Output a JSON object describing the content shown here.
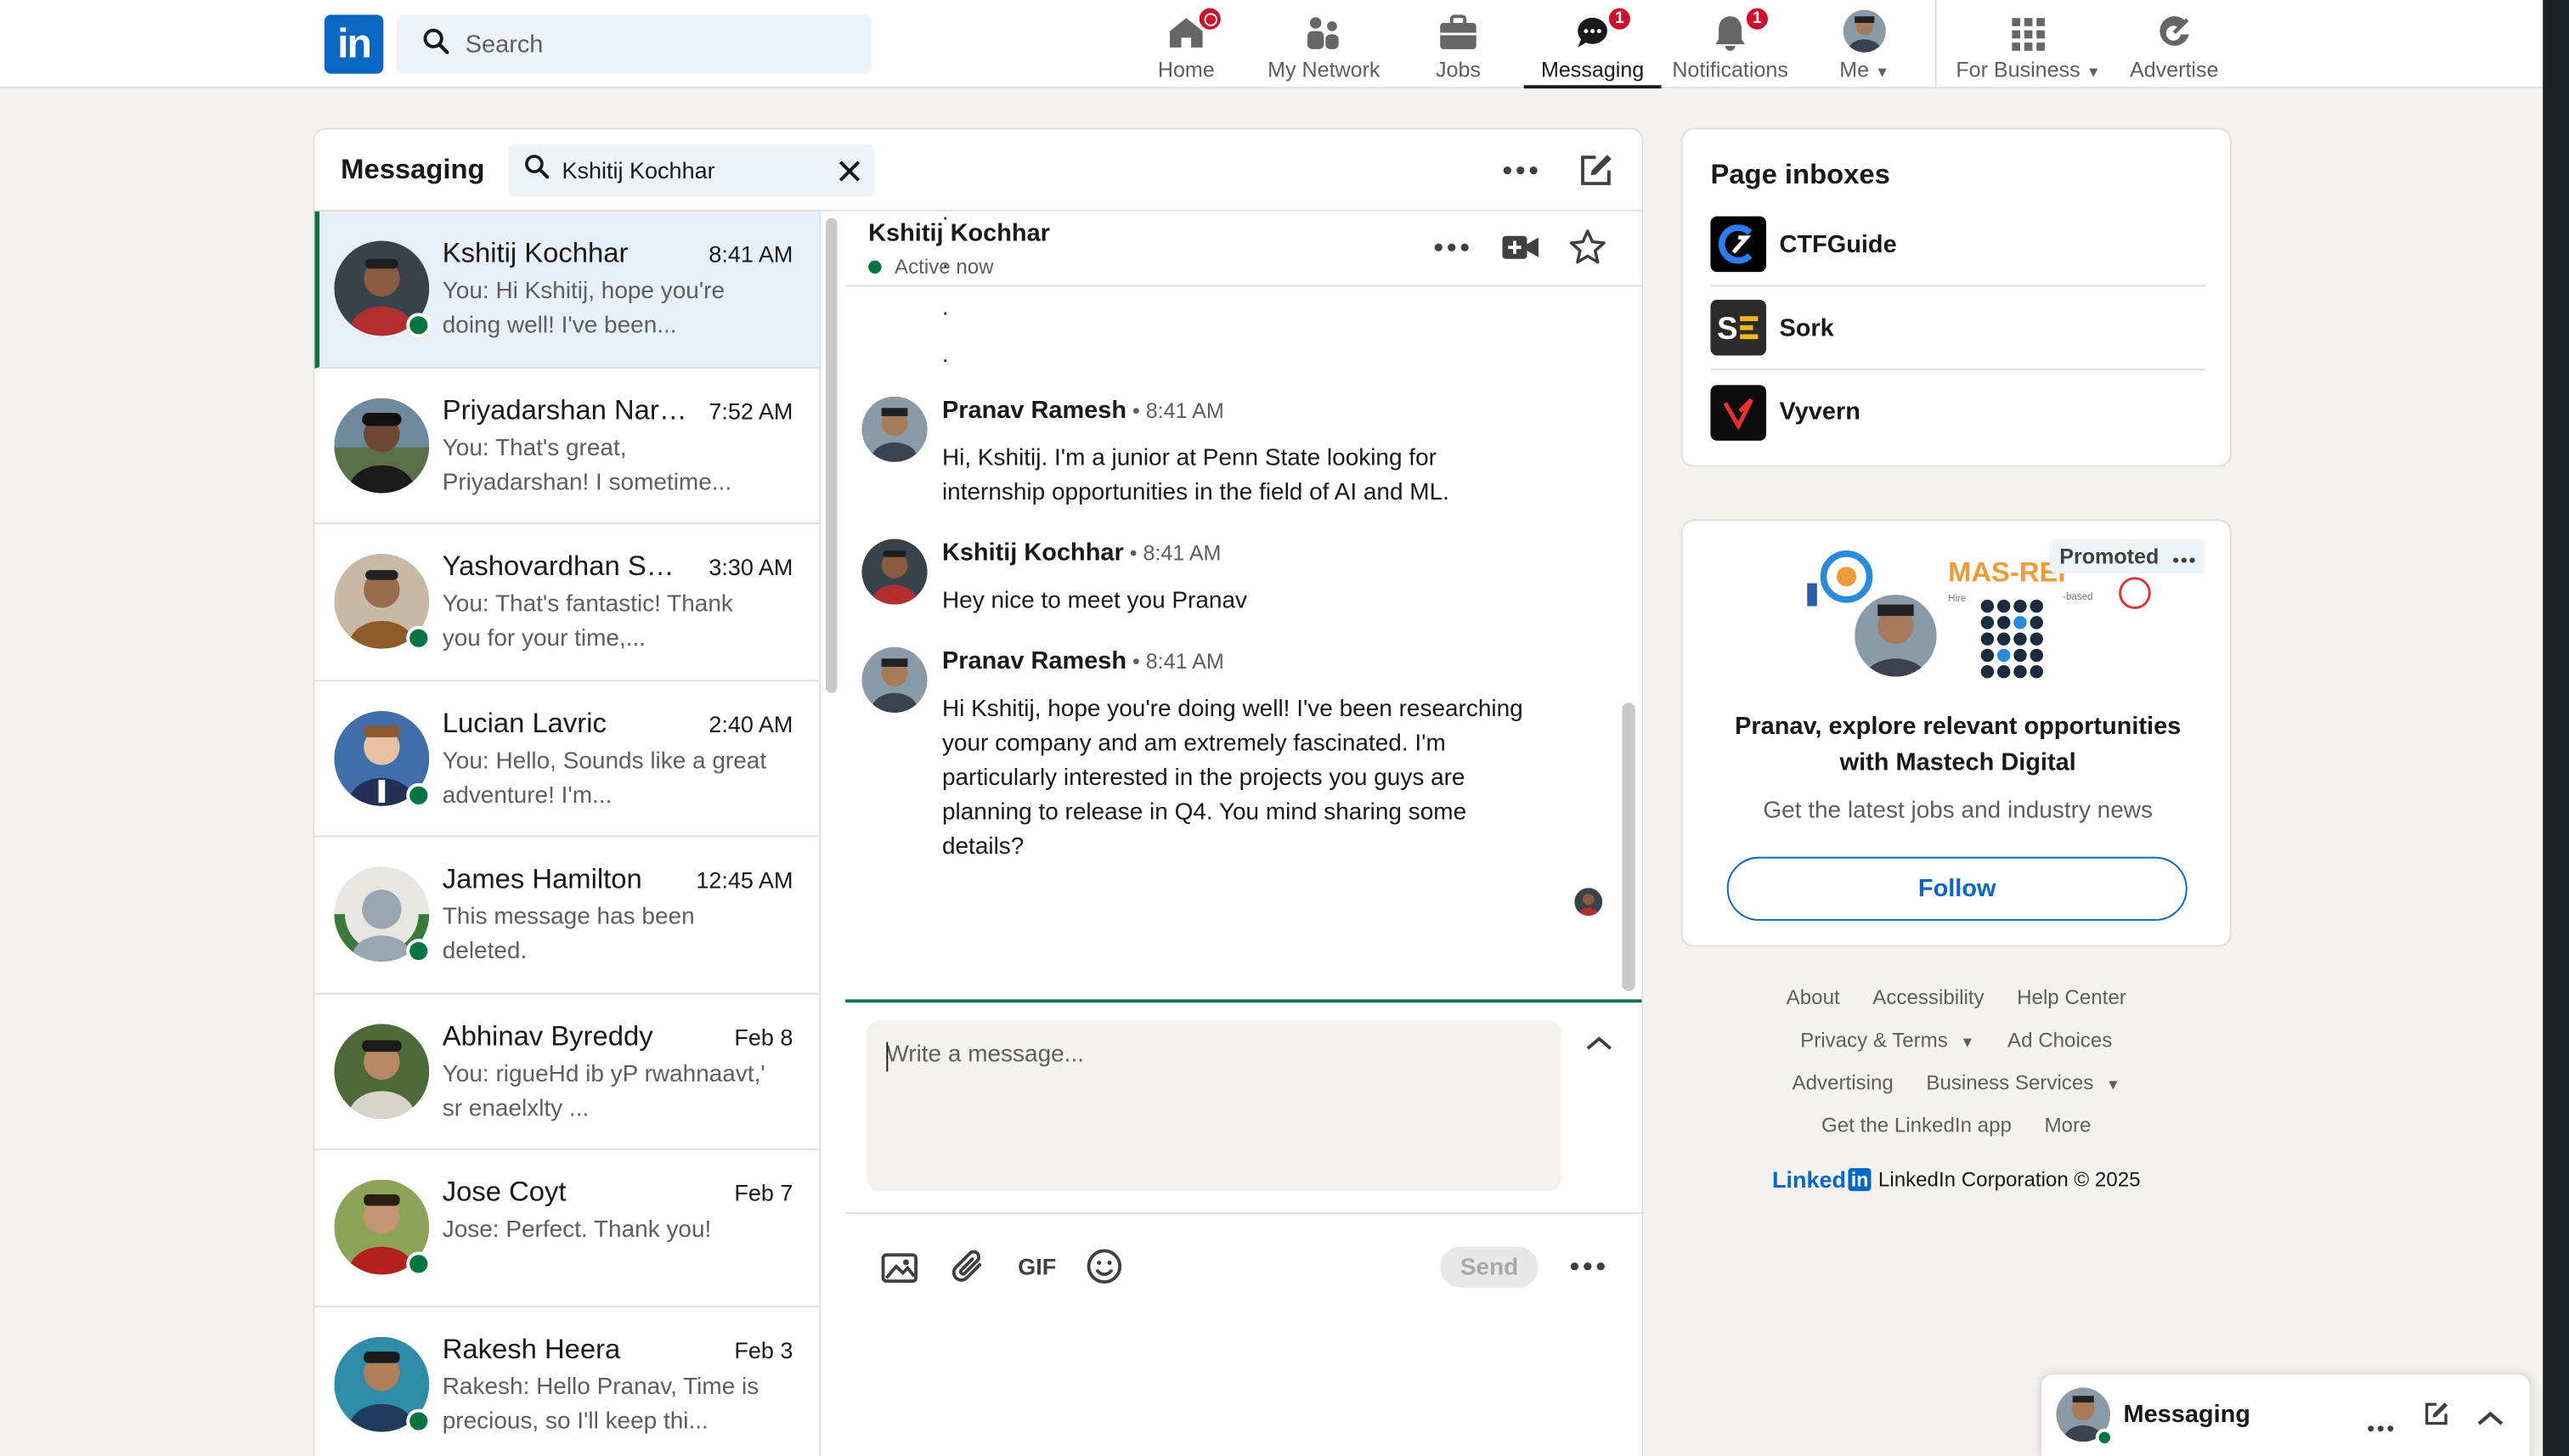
{
  "nav": {
    "logo": "in",
    "search_placeholder": "Search",
    "items": [
      {
        "label": "Home",
        "badge": ""
      },
      {
        "label": "My Network",
        "badge": ""
      },
      {
        "label": "Jobs",
        "badge": ""
      },
      {
        "label": "Messaging",
        "badge": "1"
      },
      {
        "label": "Notifications",
        "badge": "1"
      },
      {
        "label": "Me",
        "badge": ""
      },
      {
        "label": "For Business",
        "badge": ""
      },
      {
        "label": "Advertise",
        "badge": ""
      }
    ]
  },
  "messaging": {
    "title": "Messaging",
    "search_value": "Kshitij Kochhar",
    "conversations": [
      {
        "name": "Kshitij Kochhar",
        "time": "8:41 AM",
        "snippet": "You: Hi Kshitij, hope you're doing well! I've been...",
        "online": true,
        "active": true
      },
      {
        "name": "Priyadarshan Narasimhan",
        "time": "7:52 AM",
        "snippet": "You: That's great, Priyadarshan! I sometime...",
        "online": false,
        "active": false
      },
      {
        "name": "Yashovardhan Sardana",
        "time": "3:30 AM",
        "snippet": "You: That's fantastic! Thank you for your time,...",
        "online": true,
        "active": false
      },
      {
        "name": "Lucian Lavric",
        "time": "2:40 AM",
        "snippet": "You: Hello,  Sounds like a great adventure! I'm...",
        "online": true,
        "active": false
      },
      {
        "name": "James Hamilton",
        "time": "12:45 AM",
        "snippet": "This message has been deleted.",
        "online": true,
        "active": false
      },
      {
        "name": "Abhinav Byreddy",
        "time": "Feb 8",
        "snippet": "You: rigueHd ib yP rwahnaavt,' sr enaelxlty ...",
        "online": false,
        "active": false
      },
      {
        "name": "Jose Coyt",
        "time": "Feb 7",
        "snippet": "Jose: Perfect. Thank you!",
        "online": true,
        "active": false
      },
      {
        "name": "Rakesh Heera",
        "time": "Feb 3",
        "snippet": "Rakesh: Hello Pranav, Time is precious, so I'll keep thi...",
        "online": true,
        "active": false
      }
    ]
  },
  "thread": {
    "name": "Kshitij Kochhar",
    "status": "Active now",
    "dots": [
      ".",
      ".",
      ".",
      "."
    ],
    "messages": [
      {
        "sender": "Pranav Ramesh",
        "time": " • 8:41 AM",
        "text": "Hi, Kshitij. I'm a junior at Penn State looking for internship opportunities in the field of AI and ML."
      },
      {
        "sender": "Kshitij Kochhar",
        "time": " • 8:41 AM",
        "text": "Hey nice to meet you Pranav"
      },
      {
        "sender": "Pranav Ramesh",
        "time": " • 8:41 AM",
        "text": "Hi Kshitij, hope you're doing well! I've been researching your company and am extremely fascinated. I'm particularly interested in the projects you guys are planning to release in Q4. You mind sharing some details?"
      }
    ],
    "compose_placeholder": "Write a message...",
    "gif_label": "GIF",
    "send_label": "Send"
  },
  "page_inboxes": {
    "title": "Page inboxes",
    "items": [
      "CTFGuide",
      "Sork",
      "Vyvern"
    ]
  },
  "ad": {
    "promoted": "Promoted",
    "banner_text": "MAS-REI",
    "headline": "Pranav, explore relevant opportunities with Mastech Digital",
    "sub": "Get the latest jobs and industry news",
    "follow": "Follow"
  },
  "footer": {
    "links": [
      "About",
      "Accessibility",
      "Help Center",
      "Privacy & Terms",
      "Ad Choices",
      "Advertising",
      "Business Services",
      "Get the LinkedIn app",
      "More"
    ],
    "brand": "Linked",
    "brand_in": "in",
    "copyright": "LinkedIn Corporation © 2025"
  },
  "mini_messaging": {
    "title": "Messaging"
  },
  "colors": {
    "brand": "#0a66c2",
    "online": "#057642",
    "badge": "#cb112d"
  }
}
